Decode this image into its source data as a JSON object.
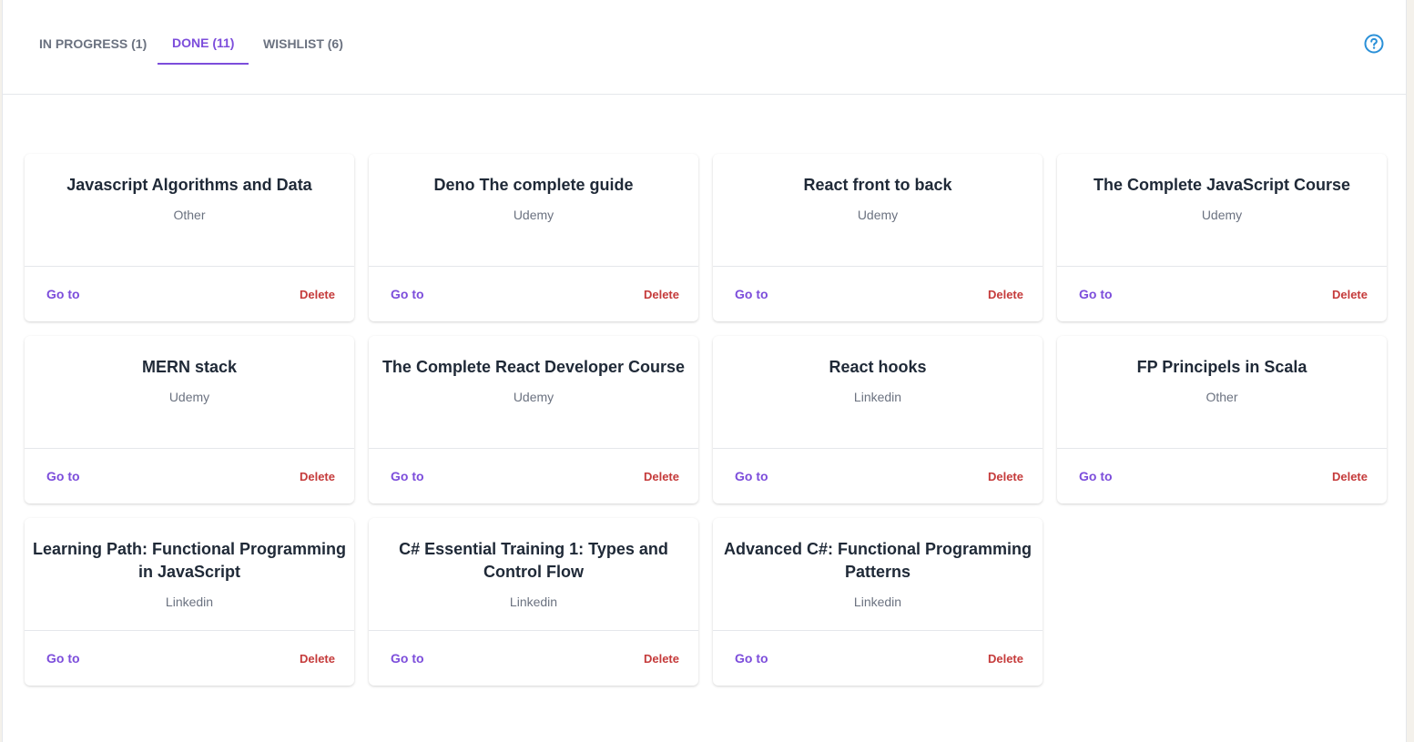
{
  "tabs": [
    {
      "label": "IN PROGRESS (1)",
      "active": false
    },
    {
      "label": "DONE (11)",
      "active": true
    },
    {
      "label": "WISHLIST (6)",
      "active": false
    }
  ],
  "help_icon": "question-circle-icon",
  "colors": {
    "accent": "#7c4ddb",
    "danger": "#c53b3b",
    "help": "#2a90d8"
  },
  "courses": [
    {
      "title": "Javascript Algorithms and Data",
      "provider": "Other",
      "goto": "Go to",
      "delete": "Delete"
    },
    {
      "title": "Deno The complete guide",
      "provider": "Udemy",
      "goto": "Go to",
      "delete": "Delete"
    },
    {
      "title": "React front to back",
      "provider": "Udemy",
      "goto": "Go to",
      "delete": "Delete"
    },
    {
      "title": "The Complete JavaScript Course",
      "provider": "Udemy",
      "goto": "Go to",
      "delete": "Delete"
    },
    {
      "title": "MERN stack",
      "provider": "Udemy",
      "goto": "Go to",
      "delete": "Delete"
    },
    {
      "title": "The Complete React Developer Course",
      "provider": "Udemy",
      "goto": "Go to",
      "delete": "Delete"
    },
    {
      "title": "React hooks",
      "provider": "Linkedin",
      "goto": "Go to",
      "delete": "Delete"
    },
    {
      "title": "FP Principels in Scala",
      "provider": "Other",
      "goto": "Go to",
      "delete": "Delete"
    },
    {
      "title": "Learning Path: Functional Programming in JavaScript",
      "provider": "Linkedin",
      "goto": "Go to",
      "delete": "Delete"
    },
    {
      "title": "C# Essential Training 1: Types and Control Flow",
      "provider": "Linkedin",
      "goto": "Go to",
      "delete": "Delete"
    },
    {
      "title": "Advanced C#: Functional Programming Patterns",
      "provider": "Linkedin",
      "goto": "Go to",
      "delete": "Delete"
    }
  ]
}
